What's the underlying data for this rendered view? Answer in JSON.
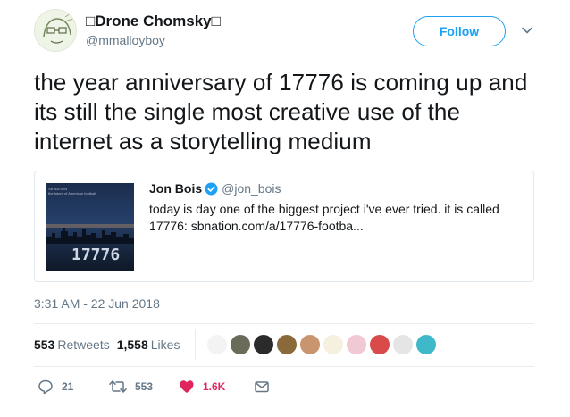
{
  "tweet": {
    "author": {
      "display_name": "□Drone Chomsky□",
      "handle": "@mmalloyboy",
      "avatar_icon": "avatar-doodle-face"
    },
    "follow_label": "Follow",
    "text": "the year anniversary of 17776 is coming up and its still the single most creative use of the internet as a storytelling medium",
    "quoted": {
      "author_name": "Jon Bois",
      "author_handle": "@jon_bois",
      "verified": true,
      "text": "today is day one of the biggest project i've ever tried. it is called 17776: sbnation.com/a/17776-footba...",
      "thumbnail": {
        "brand": "SB NATION",
        "caption": "the future of American football",
        "title": "17776"
      }
    },
    "timestamp": "3:31 AM - 22 Jun 2018",
    "stats": {
      "retweets_count": "553",
      "retweets_label": "Retweets",
      "likes_count": "1,558",
      "likes_label": "Likes"
    },
    "likers_count_shown": 10,
    "actions": {
      "reply_count": "21",
      "retweet_count": "553",
      "like_count": "1.6K"
    }
  },
  "colors": {
    "accent": "#1da1f2",
    "secondary_text": "#657786",
    "like_red": "#e0245e",
    "border": "#e1e8ed"
  }
}
